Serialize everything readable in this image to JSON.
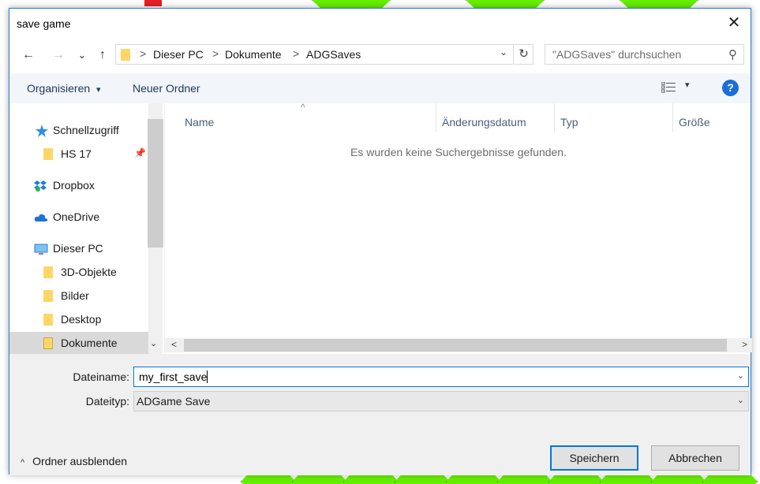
{
  "dialog": {
    "title": "save game",
    "close_glyph": "✕"
  },
  "nav": {
    "back_glyph": "←",
    "forward_glyph": "→",
    "recent_glyph": "⌄",
    "up_glyph": "↑",
    "breadcrumbs": [
      "Dieser PC",
      "Dokumente",
      "ADGSaves"
    ],
    "crumb_separator": ">",
    "refresh_glyph": "↻",
    "dropdown_glyph": "⌄",
    "search_placeholder": "\"ADGSaves\" durchsuchen",
    "search_icon": "⚲"
  },
  "toolbar": {
    "organize_label": "Organisieren",
    "organize_caret": "▾",
    "new_folder_label": "Neuer Ordner",
    "view_caret": "▾",
    "help_label": "?"
  },
  "navpane": {
    "items": [
      {
        "label": "Schnellzugriff",
        "icon": "star-icon"
      },
      {
        "label": "HS 17",
        "icon": "folder-icon",
        "pinned": true
      },
      {
        "label": "Dropbox",
        "icon": "dropbox-icon"
      },
      {
        "label": "OneDrive",
        "icon": "cloud-icon"
      },
      {
        "label": "Dieser PC",
        "icon": "computer-icon"
      },
      {
        "label": "3D-Objekte",
        "icon": "folder-icon"
      },
      {
        "label": "Bilder",
        "icon": "folder-icon"
      },
      {
        "label": "Desktop",
        "icon": "folder-icon"
      },
      {
        "label": "Dokumente",
        "icon": "document-folder-icon",
        "selected": true
      }
    ],
    "pin_glyph": "📌",
    "scroll_down_glyph": "⌄"
  },
  "list": {
    "columns": [
      "Name",
      "Änderungsdatum",
      "Typ",
      "Größe"
    ],
    "sort_glyph": "^",
    "empty_message": "Es wurden keine Suchergebnisse gefunden.",
    "scroll_left_glyph": "<",
    "scroll_right_glyph": ">"
  },
  "form": {
    "filename_label": "Dateiname:",
    "filename_value": "my_first_save",
    "filetype_label": "Dateityp:",
    "filetype_value": "ADGame Save",
    "hide_folders_label": "Ordner ausblenden",
    "hide_folders_caret": "^",
    "save_label": "Speichern",
    "cancel_label": "Abbrechen"
  },
  "colors": {
    "accent": "#0078d7",
    "board_green": "#66ee00",
    "help_blue": "#1a6ed8"
  }
}
